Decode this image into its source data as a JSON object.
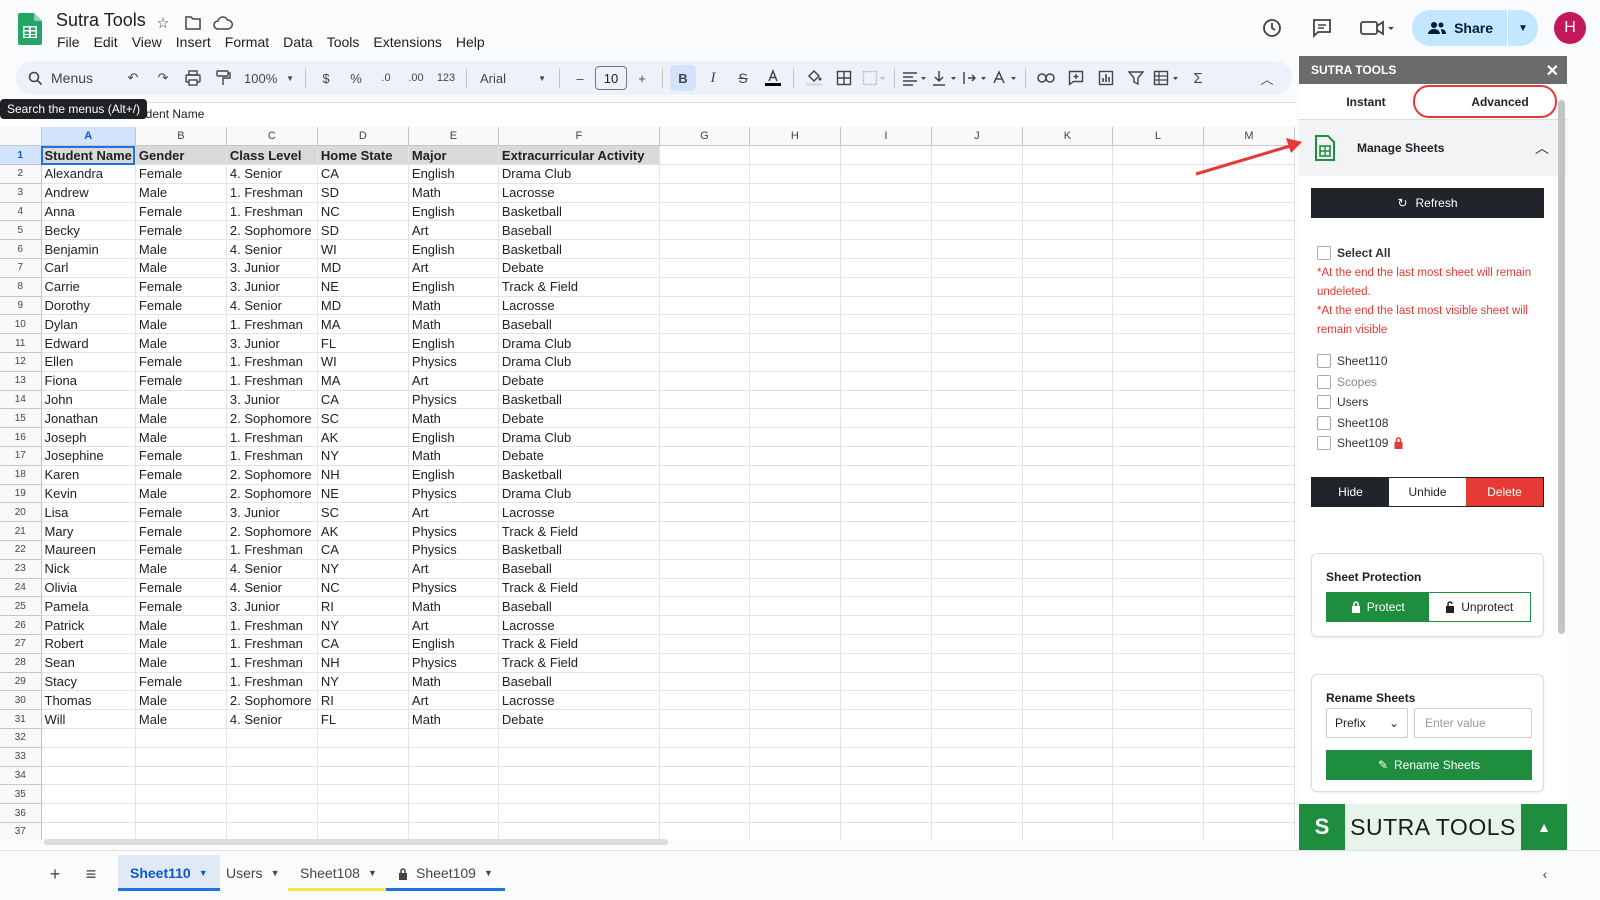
{
  "header": {
    "doc_title": "Sutra Tools",
    "menu": [
      "File",
      "Edit",
      "View",
      "Insert",
      "Format",
      "Data",
      "Tools",
      "Extensions",
      "Help"
    ],
    "share_label": "Share",
    "avatar_letter": "H"
  },
  "toolbar": {
    "search_label": "Menus",
    "zoom": "100%",
    "currency": "$",
    "percent": "%",
    "dec_decrease": ".0",
    "dec_increase": ".00",
    "number_format": "123",
    "font": "Arial",
    "font_size": "10",
    "minus": "–",
    "plus": "+",
    "bold": "B",
    "italic": "I",
    "sigma": "Σ"
  },
  "tooltip": "Search the menus (Alt+/)",
  "formula": {
    "content": "udent Name"
  },
  "grid": {
    "columns": [
      "A",
      "B",
      "C",
      "D",
      "E",
      "F",
      "G",
      "H",
      "I",
      "J",
      "K",
      "L",
      "M"
    ],
    "header_row": [
      "Student Name",
      "Gender",
      "Class Level",
      "Home State",
      "Major",
      "Extracurricular Activity"
    ],
    "rows": [
      [
        "Alexandra",
        "Female",
        "4. Senior",
        "CA",
        "English",
        "Drama Club"
      ],
      [
        "Andrew",
        "Male",
        "1. Freshman",
        "SD",
        "Math",
        "Lacrosse"
      ],
      [
        "Anna",
        "Female",
        "1. Freshman",
        "NC",
        "English",
        "Basketball"
      ],
      [
        "Becky",
        "Female",
        "2. Sophomore",
        "SD",
        "Art",
        "Baseball"
      ],
      [
        "Benjamin",
        "Male",
        "4. Senior",
        "WI",
        "English",
        "Basketball"
      ],
      [
        "Carl",
        "Male",
        "3. Junior",
        "MD",
        "Art",
        "Debate"
      ],
      [
        "Carrie",
        "Female",
        "3. Junior",
        "NE",
        "English",
        "Track & Field"
      ],
      [
        "Dorothy",
        "Female",
        "4. Senior",
        "MD",
        "Math",
        "Lacrosse"
      ],
      [
        "Dylan",
        "Male",
        "1. Freshman",
        "MA",
        "Math",
        "Baseball"
      ],
      [
        "Edward",
        "Male",
        "3. Junior",
        "FL",
        "English",
        "Drama Club"
      ],
      [
        "Ellen",
        "Female",
        "1. Freshman",
        "WI",
        "Physics",
        "Drama Club"
      ],
      [
        "Fiona",
        "Female",
        "1. Freshman",
        "MA",
        "Art",
        "Debate"
      ],
      [
        "John",
        "Male",
        "3. Junior",
        "CA",
        "Physics",
        "Basketball"
      ],
      [
        "Jonathan",
        "Male",
        "2. Sophomore",
        "SC",
        "Math",
        "Debate"
      ],
      [
        "Joseph",
        "Male",
        "1. Freshman",
        "AK",
        "English",
        "Drama Club"
      ],
      [
        "Josephine",
        "Female",
        "1. Freshman",
        "NY",
        "Math",
        "Debate"
      ],
      [
        "Karen",
        "Female",
        "2. Sophomore",
        "NH",
        "English",
        "Basketball"
      ],
      [
        "Kevin",
        "Male",
        "2. Sophomore",
        "NE",
        "Physics",
        "Drama Club"
      ],
      [
        "Lisa",
        "Female",
        "3. Junior",
        "SC",
        "Art",
        "Lacrosse"
      ],
      [
        "Mary",
        "Female",
        "2. Sophomore",
        "AK",
        "Physics",
        "Track & Field"
      ],
      [
        "Maureen",
        "Female",
        "1. Freshman",
        "CA",
        "Physics",
        "Basketball"
      ],
      [
        "Nick",
        "Male",
        "4. Senior",
        "NY",
        "Art",
        "Baseball"
      ],
      [
        "Olivia",
        "Female",
        "4. Senior",
        "NC",
        "Physics",
        "Track & Field"
      ],
      [
        "Pamela",
        "Female",
        "3. Junior",
        "RI",
        "Math",
        "Baseball"
      ],
      [
        "Patrick",
        "Male",
        "1. Freshman",
        "NY",
        "Art",
        "Lacrosse"
      ],
      [
        "Robert",
        "Male",
        "1. Freshman",
        "CA",
        "English",
        "Track & Field"
      ],
      [
        "Sean",
        "Male",
        "1. Freshman",
        "NH",
        "Physics",
        "Track & Field"
      ],
      [
        "Stacy",
        "Female",
        "1. Freshman",
        "NY",
        "Math",
        "Baseball"
      ],
      [
        "Thomas",
        "Male",
        "2. Sophomore",
        "RI",
        "Art",
        "Lacrosse"
      ],
      [
        "Will",
        "Male",
        "4. Senior",
        "FL",
        "Math",
        "Debate"
      ]
    ],
    "empty_row_numbers": [
      "32",
      "33",
      "34",
      "35",
      "36",
      "37"
    ]
  },
  "sheet_tabs": [
    {
      "label": "Sheet110",
      "active": true,
      "underline": "#1a73e8",
      "locked": false
    },
    {
      "label": "Users",
      "active": false,
      "underline": "",
      "locked": false
    },
    {
      "label": "Sheet108",
      "active": false,
      "underline": "#f4e542",
      "locked": false
    },
    {
      "label": "Sheet109",
      "active": false,
      "underline": "#1a73e8",
      "locked": true
    }
  ],
  "panel": {
    "title": "SUTRA TOOLS",
    "tabs": [
      "Instant",
      "Advanced"
    ],
    "section_title": "Manage Sheets",
    "refresh_label": "Refresh",
    "select_all": "Select All",
    "warnings": [
      "*At the end the last most sheet will remain undeleted.",
      "*At the end the last most visible sheet will remain visible"
    ],
    "sheets": [
      {
        "label": "Sheet110",
        "muted": false,
        "locked": false
      },
      {
        "label": "Scopes",
        "muted": true,
        "locked": false
      },
      {
        "label": "Users",
        "muted": false,
        "locked": false
      },
      {
        "label": "Sheet108",
        "muted": false,
        "locked": false
      },
      {
        "label": "Sheet109",
        "muted": false,
        "locked": true
      }
    ],
    "actions": [
      "Hide",
      "Unhide",
      "Delete"
    ],
    "protection": {
      "title": "Sheet Protection",
      "protect": "Protect",
      "unprotect": "Unprotect"
    },
    "rename": {
      "title": "Rename Sheets",
      "mode": "Prefix",
      "placeholder": "Enter value",
      "button": "Rename Sheets"
    },
    "brand_text": "SUTRA TOOLS"
  },
  "colors": {
    "accent": "#1a73e8",
    "green": "#1e8e3e",
    "danger": "#e53935",
    "dark": "#212529"
  }
}
